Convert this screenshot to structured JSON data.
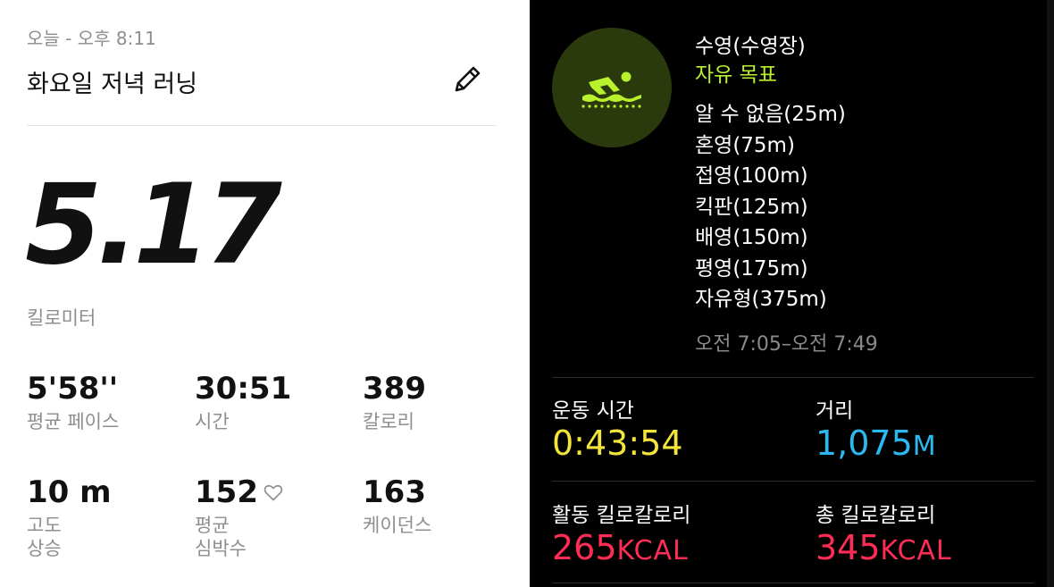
{
  "left": {
    "timestamp": "오늘 - 오후 8:11",
    "title": "화요일 저녁 러닝",
    "distance": "5.17",
    "distance_unit": "킬로미터",
    "stats": [
      {
        "value": "5'58''",
        "label": "평균 페이스"
      },
      {
        "value": "30:51",
        "label": "시간"
      },
      {
        "value": "389",
        "label": "칼로리"
      },
      {
        "value": "10 m",
        "label": "고도\n상승"
      },
      {
        "value": "152",
        "label": "평균\n심박수"
      },
      {
        "value": "163",
        "label": "케이던스"
      }
    ]
  },
  "right": {
    "workout_type": "수영(수영장)",
    "goal": "자유 목표",
    "splits": [
      "알 수 없음(25m)",
      "혼영(75m)",
      "접영(100m)",
      "킥판(125m)",
      "배영(150m)",
      "평영(175m)",
      "자유형(375m)"
    ],
    "time_range": "오전 7:05–오전 7:49",
    "metrics": {
      "workout_time": {
        "label": "운동 시간",
        "value": "0:43:54",
        "color": "#f3e53a"
      },
      "distance": {
        "label": "거리",
        "value": "1,075",
        "unit": "M",
        "color": "#2bb9f0"
      },
      "active_kcal": {
        "label": "활동 킬로칼로리",
        "value": "265",
        "unit": "KCAL",
        "color": "#ff2d55"
      },
      "total_kcal": {
        "label": "총 킬로칼로리",
        "value": "345",
        "unit": "KCAL",
        "color": "#ff2d55"
      }
    },
    "icons": {
      "swim": "swimmer-icon",
      "edit": "pencil-icon",
      "heart": "heart-icon"
    },
    "accent": "#b9f22d"
  }
}
